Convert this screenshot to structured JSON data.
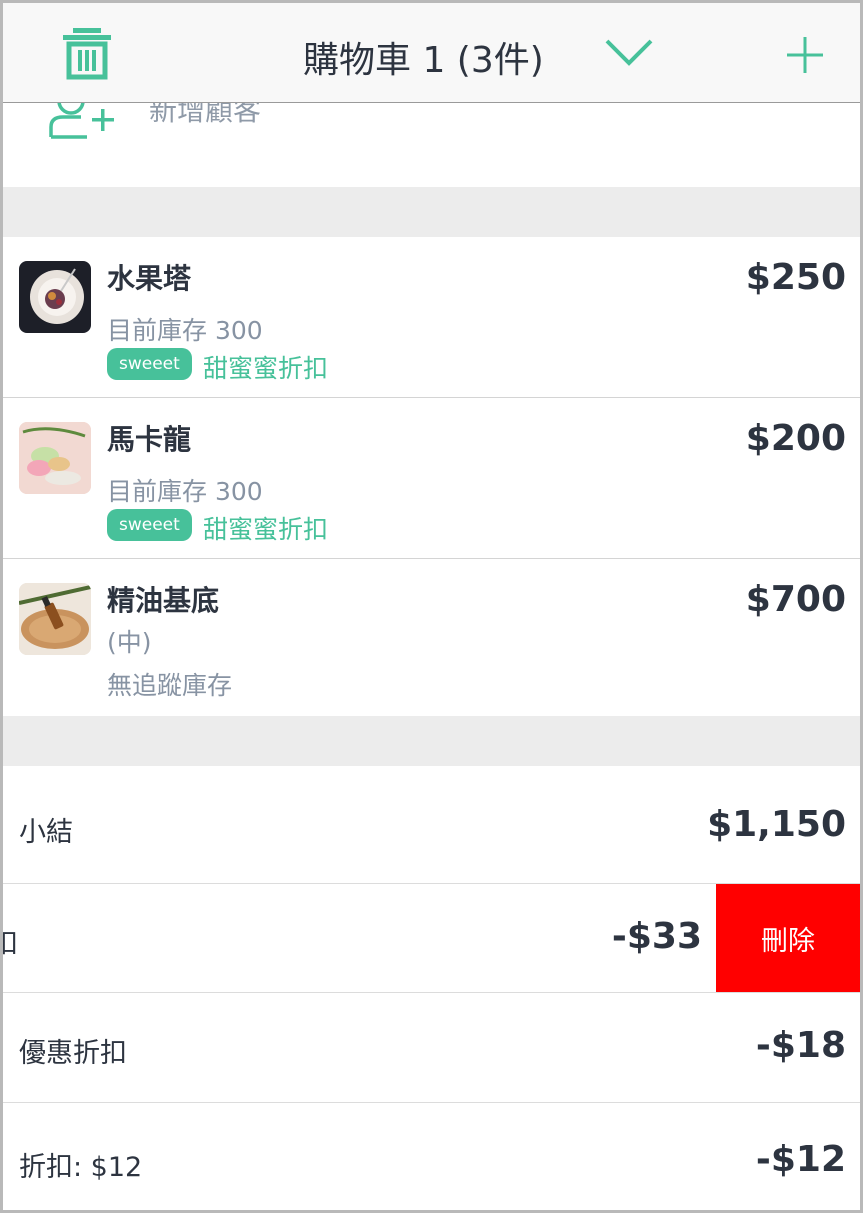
{
  "header": {
    "title": "購物車 1 (3件)",
    "icons": {
      "left": "trash-icon",
      "middle": "chevron-down-icon",
      "right": "plus-icon"
    }
  },
  "customer": {
    "label": "新增顧客",
    "icon": "add-user-icon"
  },
  "items": [
    {
      "name": "水果塔",
      "price": "$250",
      "stock": "目前庫存 300",
      "badge": "sweeet",
      "discount": "甜蜜蜜折扣"
    },
    {
      "name": "馬卡龍",
      "price": "$200",
      "stock": "目前庫存 300",
      "badge": "sweeet",
      "discount": "甜蜜蜜折扣"
    },
    {
      "name": "精油基底",
      "variant": "(中)",
      "price": "$700",
      "stock": "無追蹤庫存"
    }
  ],
  "summary": {
    "subtotal_label": "小結",
    "subtotal_value": "$1,150",
    "swiped_label_fragment": "扣",
    "swiped_value": "-$33",
    "delete_label": "刪除",
    "promo_label": "優惠折扣",
    "promo_value": "-$18",
    "discount_label": "折扣: $12",
    "discount_value": "-$12"
  },
  "colors": {
    "accent": "#47c19a",
    "danger": "#ff0000",
    "text": "#2d3440",
    "muted": "#8793a3"
  }
}
